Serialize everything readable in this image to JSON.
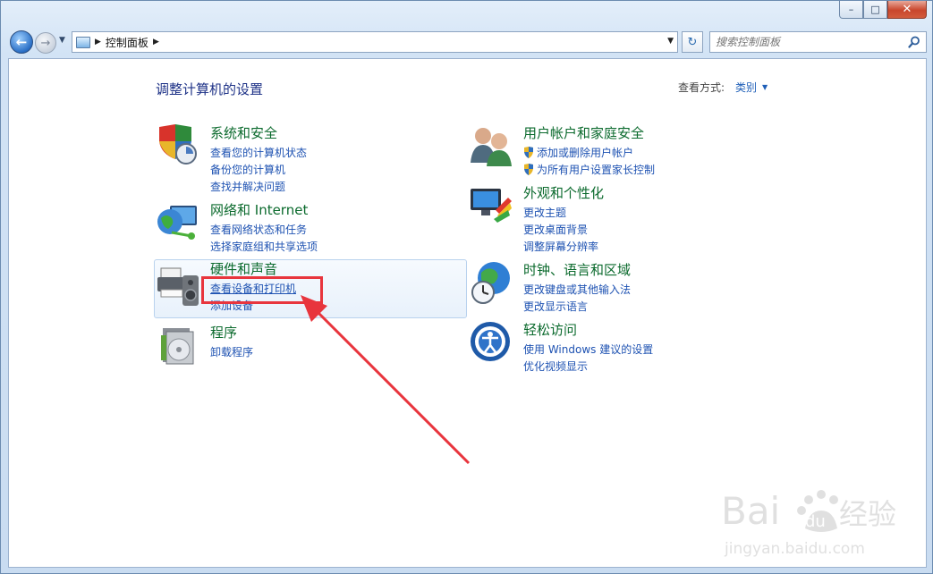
{
  "window": {
    "caption": {
      "minimize": "–",
      "maximize": "□",
      "close": "✕"
    }
  },
  "nav": {
    "back_glyph": "←",
    "forward_glyph": "→",
    "recent_glyph": "▼",
    "address_separator": "▶",
    "breadcrumb": "控制面板",
    "breadcrumb_trailing": "▶",
    "address_dropdown": "▼",
    "refresh_glyph": "↻",
    "search_placeholder": "搜索控制面板"
  },
  "page": {
    "title": "调整计算机的设置",
    "view_by_label": "查看方式:",
    "view_by_value": "类别",
    "view_by_caret": "▼"
  },
  "categories": [
    {
      "title": "系统和安全",
      "icon": "shield-computer-icon",
      "links": [
        "查看您的计算机状态",
        "备份您的计算机",
        "查找并解决问题"
      ]
    },
    {
      "title": "网络和 Internet",
      "icon": "network-globe-icon",
      "links": [
        "查看网络状态和任务",
        "选择家庭组和共享选项"
      ]
    },
    {
      "title": "硬件和声音",
      "icon": "printer-speaker-icon",
      "links": [
        "查看设备和打印机",
        "添加设备"
      ]
    },
    {
      "title": "程序",
      "icon": "programs-disc-icon",
      "links": [
        "卸载程序"
      ]
    },
    {
      "title": "用户帐户和家庭安全",
      "icon": "users-icon",
      "links": [
        "添加或删除用户帐户",
        "为所有用户设置家长控制"
      ]
    },
    {
      "title": "外观和个性化",
      "icon": "monitor-palette-icon",
      "links": [
        "更改主题",
        "更改桌面背景",
        "调整屏幕分辨率"
      ]
    },
    {
      "title": "时钟、语言和区域",
      "icon": "globe-clock-icon",
      "links": [
        "更改键盘或其他输入法",
        "更改显示语言"
      ]
    },
    {
      "title": "轻松访问",
      "icon": "ease-of-access-icon",
      "links": [
        "使用 Windows 建议的设置",
        "优化视频显示"
      ]
    }
  ],
  "watermark": {
    "brand": "Bai",
    "brand2": "du",
    "brand3": "经验",
    "url": "jingyan.baidu.com"
  },
  "colors": {
    "title": "#1e3287",
    "category": "#0b6a2d",
    "link": "#1e52b2",
    "annotation": "#e8353d"
  }
}
